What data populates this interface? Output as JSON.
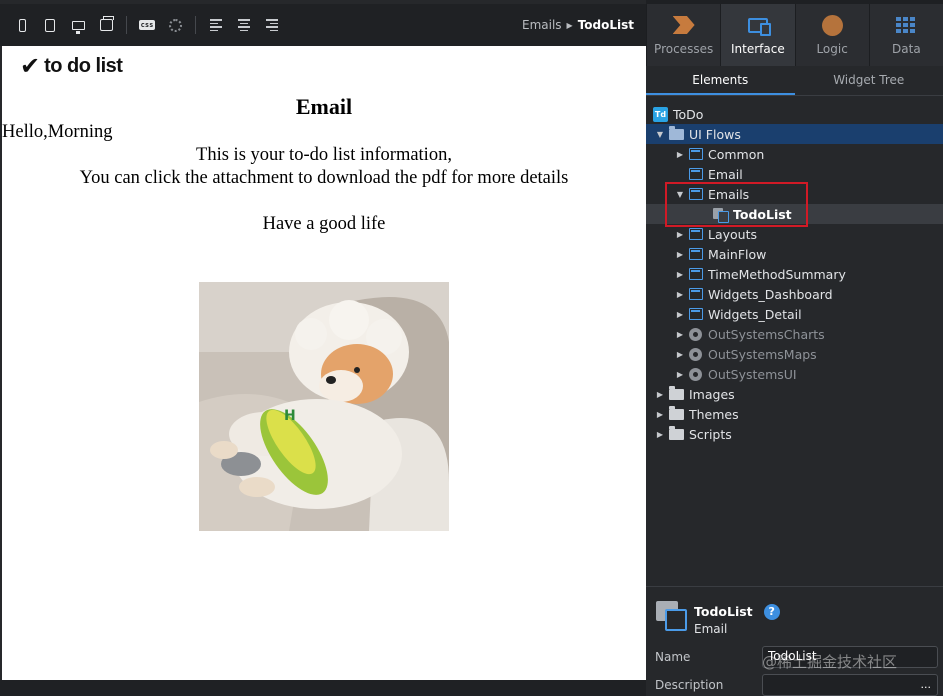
{
  "toolbar": {
    "breadcrumb": {
      "parent": "Emails",
      "current": "TodoList"
    }
  },
  "canvas": {
    "logo_text": "to do list",
    "title": "Email",
    "greeting": "Hello,Morning",
    "line1": "This is your to-do list information,",
    "line2": "You can click the attachment to download the pdf for more details",
    "line3": "Have a good life",
    "photo_alt": "shiba inu dog in sheep costume"
  },
  "tabs": [
    {
      "label": "Processes",
      "icon": "processes-icon"
    },
    {
      "label": "Interface",
      "icon": "interface-icon"
    },
    {
      "label": "Logic",
      "icon": "logic-icon"
    },
    {
      "label": "Data",
      "icon": "data-icon"
    }
  ],
  "subtabs": [
    "Elements",
    "Widget Tree"
  ],
  "tree": {
    "root": "ToDo",
    "ui_flows": "UI Flows",
    "items": [
      "Common",
      "Email",
      "Emails",
      "TodoList",
      "Layouts",
      "MainFlow",
      "TimeMethodSummary",
      "Widgets_Dashboard",
      "Widgets_Detail",
      "OutSystemsCharts",
      "OutSystemsMaps",
      "OutSystemsUI"
    ],
    "folders": [
      "Images",
      "Themes",
      "Scripts"
    ]
  },
  "props": {
    "title": "TodoList",
    "subtitle": "Email",
    "name_label": "Name",
    "name_value": "TodoList",
    "description_label": "Description",
    "more": "...",
    "watermark": "@稀土掘金技术社区"
  },
  "colors": {
    "accent": "#3d8fe0",
    "highlight": "#d11a26",
    "selected_row": "#1a3f6e"
  }
}
